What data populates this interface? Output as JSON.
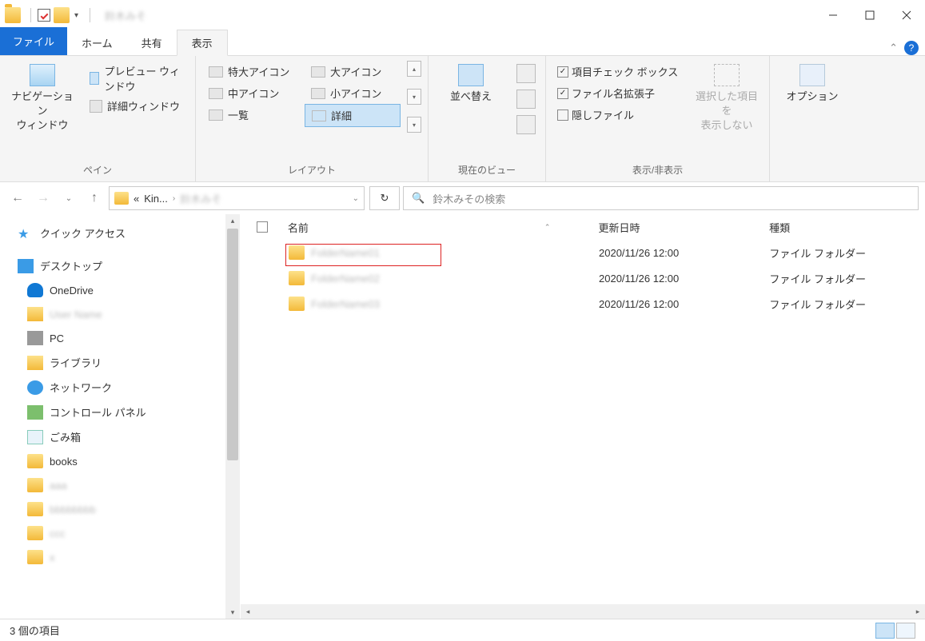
{
  "window": {
    "title_blur": "鈴木みそ"
  },
  "tabs": {
    "file": "ファイル",
    "home": "ホーム",
    "share": "共有",
    "view": "表示"
  },
  "ribbon": {
    "pane": {
      "nav": "ナビゲーション\nウィンドウ",
      "preview": "プレビュー ウィンドウ",
      "details": "詳細ウィンドウ",
      "label": "ペイン"
    },
    "layout": {
      "xl": "特大アイコン",
      "lg": "大アイコン",
      "md": "中アイコン",
      "sm": "小アイコン",
      "list": "一覧",
      "detail": "詳細",
      "label": "レイアウト"
    },
    "view": {
      "sort": "並べ替え",
      "label": "現在のビュー"
    },
    "show": {
      "checkbox": "項目チェック ボックス",
      "ext": "ファイル名拡張子",
      "hidden": "隠しファイル",
      "hidesel": "選択した項目を\n表示しない",
      "label": "表示/非表示"
    },
    "options": "オプション"
  },
  "addr": {
    "crumb1": "Kin...",
    "crumb2_blur": "鈴木みそ"
  },
  "search": {
    "placeholder": "鈴木みその検索"
  },
  "tree": {
    "quick": "クイック アクセス",
    "desktop": "デスクトップ",
    "onedrive": "OneDrive",
    "user_blur": "User Name",
    "pc": "PC",
    "library": "ライブラリ",
    "network": "ネットワーク",
    "control": "コントロール パネル",
    "trash": "ごみ箱",
    "books": "books",
    "b1": "aaa",
    "b2": "bbbbbbbb",
    "b3": "ccc"
  },
  "columns": {
    "name": "名前",
    "date": "更新日時",
    "type": "種類"
  },
  "rows": [
    {
      "name_blur": "FolderName01",
      "date": "2020/11/26 12:00",
      "type": "ファイル フォルダー",
      "hl": true
    },
    {
      "name_blur": "FolderName02",
      "date": "2020/11/26 12:00",
      "type": "ファイル フォルダー",
      "hl": false
    },
    {
      "name_blur": "FolderName03",
      "date": "2020/11/26 12:00",
      "type": "ファイル フォルダー",
      "hl": false
    }
  ],
  "status": "3 個の項目"
}
